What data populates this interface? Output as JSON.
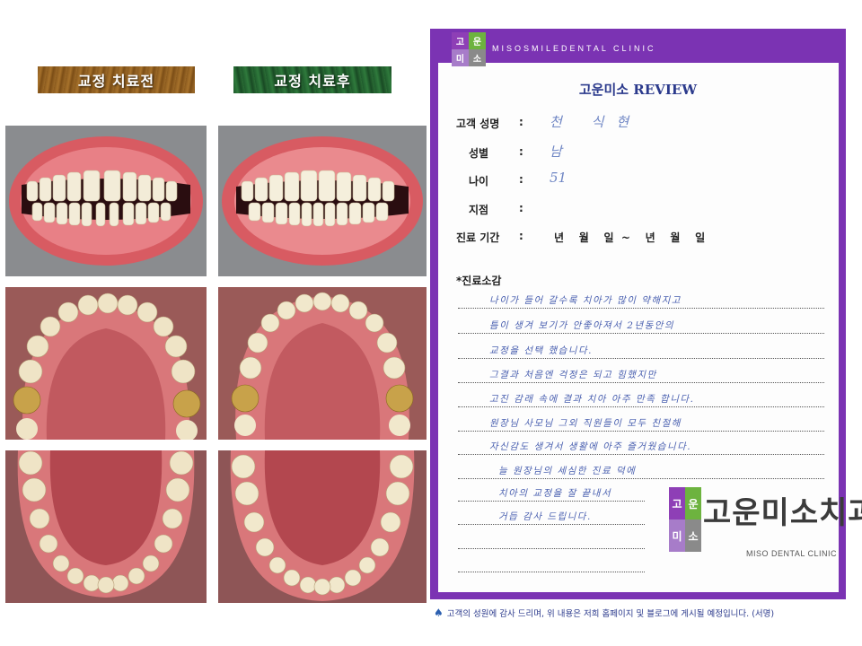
{
  "comparison": {
    "before_label": "교정 치료전",
    "after_label": "교정 치료후",
    "photos": [
      {
        "name": "before-frontal-photo"
      },
      {
        "name": "after-frontal-photo"
      },
      {
        "name": "before-upper-arch-photo"
      },
      {
        "name": "after-upper-arch-photo"
      },
      {
        "name": "before-lower-arch-photo"
      },
      {
        "name": "after-lower-arch-photo"
      }
    ]
  },
  "form": {
    "header_logo_chars": [
      "고",
      "운",
      "미",
      "소"
    ],
    "clinic_header": "MISOSMILEDENTAL CLINIC",
    "title": "고운미소 REVIEW",
    "fields": [
      {
        "label": "고객 성명",
        "colon": ":",
        "value": "천 식현"
      },
      {
        "label": "성별",
        "colon": ":",
        "value": "남"
      },
      {
        "label": "나이",
        "colon": ":",
        "value": "51"
      },
      {
        "label": "지점",
        "colon": ":",
        "value": ""
      },
      {
        "label": "진료 기간",
        "colon": ":",
        "value": ""
      }
    ],
    "period_text": "년    월    일  ~    년    월    일",
    "remarks_title": "*진료소감",
    "remarks_lines": [
      "나이가 들어 갈수록 치아가 많이 약해지고",
      "틈이 생겨 보기가 안좋아져서 2년동안의",
      "교정을 선택 했습니다.",
      "그결과 처음엔 걱정은 되고 힘했지만",
      "고진 감래 속에 결과 치아 아주 만족 합니다.",
      "원장님 사모님 그외 직원들이 모두 친절해",
      "자신감도 생겨서 생활에 아주 즐거웠습니다.",
      "늘 원장님의 세심한 진료 덕에",
      "치아의 교정을 잘 끝내서",
      "거듭 감사 드립니다.",
      "",
      ""
    ],
    "big_logo_chars": [
      "고",
      "운",
      "미",
      "소"
    ],
    "clinic_name_ko": "고운미소치과",
    "clinic_name_en": "MISO DENTAL CLINIC",
    "footer_note": "고객의 성원에 감사 드리며, 위 내용은 저희 홈페이지 및 블로그에 게시될 예정입니다. (서명)",
    "footer_icon": "spade-icon"
  },
  "colors": {
    "frame_purple": "#7b33b3",
    "title_navy": "#2b3a8c",
    "logo_purple": "#8e3fb6",
    "logo_green": "#6db33f",
    "logo_lilac": "#a77cc9",
    "logo_gray": "#8a8a8a",
    "handwriting_blue": "#4a60b0"
  }
}
